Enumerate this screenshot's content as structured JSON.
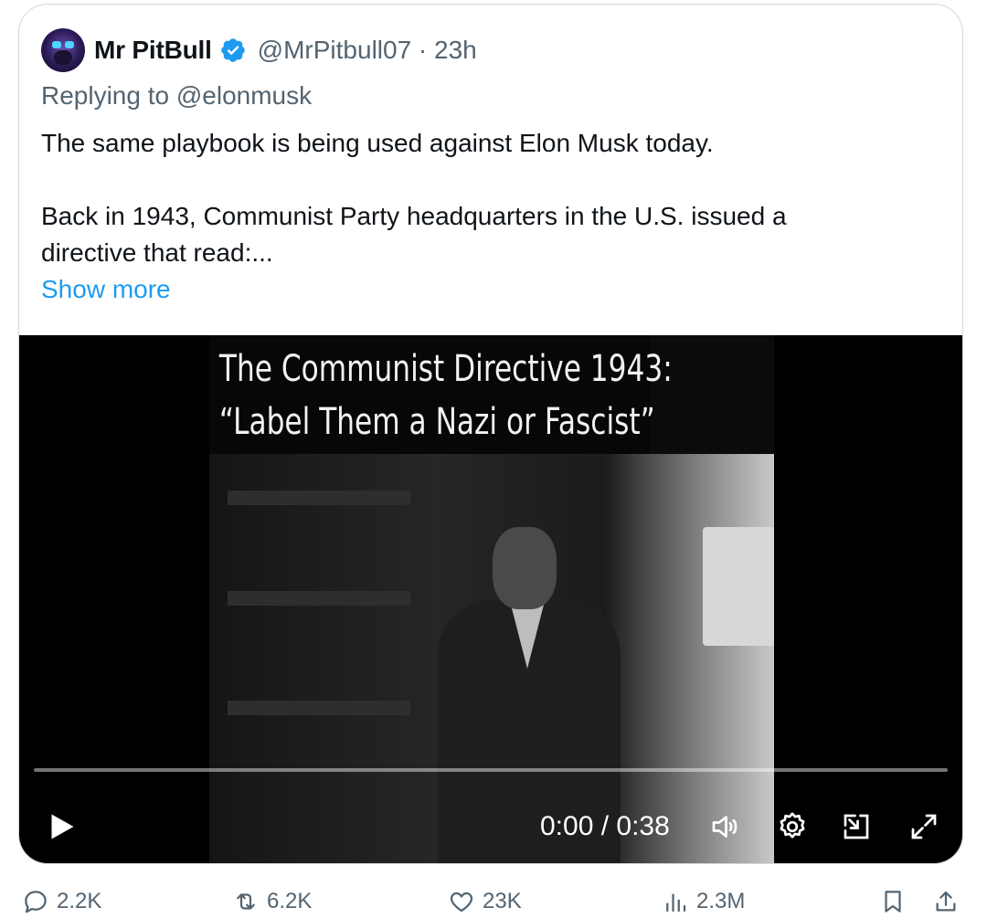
{
  "tweet": {
    "author_name": "Mr PitBull",
    "handle_time": "@MrPitbull07 · 23h",
    "replying_to": "Replying to @elonmusk",
    "text_line1": "The same playbook is being used against Elon Musk today.",
    "text_line2": "Back in 1943, Communist Party headquarters in the U.S. issued a",
    "text_line3": "directive that read:...",
    "show_more": "Show more"
  },
  "video": {
    "caption_line1": "The Communist Directive 1943:",
    "caption_line2": "“Label Them a Nazi or Fascist”",
    "time": "0:00 / 0:38",
    "progress": 0
  },
  "actions": {
    "replies": "2.2K",
    "reposts": "6.2K",
    "likes": "23K",
    "views": "2.3M"
  },
  "icons": {
    "verified": "verified-badge-icon",
    "play": "play-icon",
    "volume": "volume-icon",
    "settings": "gear-icon",
    "pip": "picture-in-picture-icon",
    "fullscreen": "fullscreen-icon",
    "reply": "reply-icon",
    "retweet": "retweet-icon",
    "like": "heart-icon",
    "views": "views-icon",
    "bookmark": "bookmark-icon",
    "share": "share-icon"
  },
  "colors": {
    "link": "#1d9bf0",
    "secondary_text": "#536471",
    "verified": "#1d9bf0",
    "border": "#cfd9de"
  }
}
